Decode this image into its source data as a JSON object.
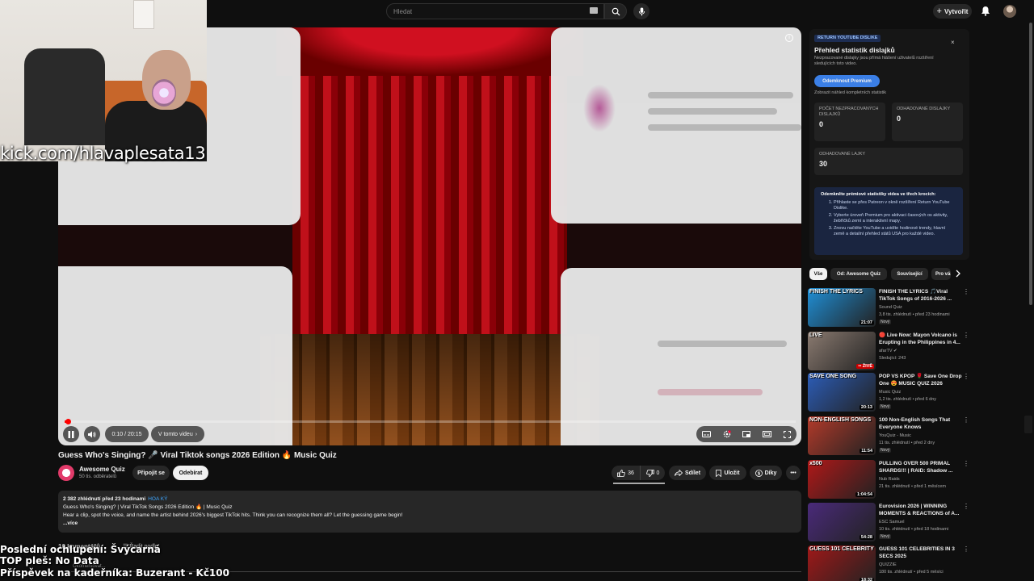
{
  "header": {
    "search_placeholder": "Hledat",
    "create_label": "Vytvořit"
  },
  "stream_overlay": {
    "kick_url": "kick.com/hlavaplesata13",
    "line1": "Poslední ochlupení: Švýcarná",
    "line2": "TOP pleš: No Data",
    "line3": "Příspěvek na kadeřníka: Buzerant - Kč100"
  },
  "player": {
    "time": "0:10 / 20:15",
    "chapter": "V tomto videu",
    "progress_fraction": 0.008
  },
  "video": {
    "title": "Guess Who's Singing? 🎤 Viral Tiktok songs 2026 Edition 🔥 Music Quiz",
    "channel": "Awesome Quiz",
    "subscribers": "50 tis. odběratelů",
    "join_label": "Připojit se",
    "subscribe_label": "Odebírat",
    "likes": "36",
    "dislikes": "0",
    "share_label": "Sdílet",
    "save_label": "Uložit",
    "thanks_label": "Díky"
  },
  "description": {
    "meta": "2 382 zhlédnutí  před 23 hodinami",
    "tag": "HOA KÝ",
    "line1": "Guess Who's Singing? | Viral TikTok Songs 2026 Edition 🔥 | Music Quiz",
    "line2": "Hear a clip, spot the voice, and name the artist behind 2026's biggest TikTok hits. Think you can recognize them all? Let the guessing game begin!",
    "more": "...více"
  },
  "comments": {
    "count_label": "10 komentářů",
    "sort_label": "Řadit podle",
    "add_placeholder": "Okomentovat..."
  },
  "ryd": {
    "badge": "RETURN YOUTUBE DISLIKE",
    "title": "Přehled statistik dislajků",
    "subtitle": "Nezpracované dislajky jsou přímá hlášení uživatelů rozšíření sledujících toto video.",
    "unlock_label": "Odemknout Premium",
    "preview_label": "Zobrazit náhled kompletních statistik",
    "stat1_label": "POČET NEZPRACOVANÝCH DISLAJKŮ",
    "stat1_value": "0",
    "stat2_label": "ODHADOVANÉ DISLAJKY",
    "stat2_value": "0",
    "stat3_label": "ODHADOVANÉ LAJKY",
    "stat3_value": "30",
    "steps_title": "Odemkněte prémiové statistiky videa ve třech krocích:",
    "step1": "Přihlaste se přes Patreon v okně rozšíření Return YouTube Dislike.",
    "step2": "Vyberte úroveň Premium pro aktivaci časových os aktivity, žebříčků zemí a interaktivní mapy.",
    "step3": "Znovu načtěte YouTube a uvidíte hodinové trendy, hlavní země a detailní přehled států USA pro každé video."
  },
  "chips": [
    "Vše",
    "Od: Awesome Quiz",
    "Související",
    "Pro vás"
  ],
  "recommendations": [
    {
      "thumb_text": "FINISH THE LYRICS",
      "thumb_color": "#1f8fd6",
      "duration": "21:07",
      "title": "FINISH THE LYRICS 🎵Viral TikTok Songs of 2016-2026 ...",
      "channel": "Sound Quiz",
      "meta": "3,8 tis. zhlédnutí • před 23 hodinami",
      "badge": "Nový"
    },
    {
      "thumb_text": "LIVE",
      "thumb_color": "#8a7a70",
      "duration": "•• ŽIVĚ",
      "title": "🔴 Live Now: Mayon Volcano is Erupting in the Philippines in 4...",
      "channel": "afarTV ✔",
      "meta": "Sledující: 243",
      "badge": ""
    },
    {
      "thumb_text": "SAVE ONE SONG",
      "thumb_color": "#2c5db8",
      "duration": "20:13",
      "title": "POP VS KPOP 🌹 Save One Drop One 😍 MUSIC QUIZ 2026",
      "channel": "Music Quiz",
      "meta": "1,2 tis. zhlédnutí • před 6 dny",
      "badge": "Nový"
    },
    {
      "thumb_text": "NON-ENGLISH SONGS",
      "thumb_color": "#b33a2a",
      "duration": "11:54",
      "title": "100 Non-English Songs That Everyone Knows",
      "channel": "YouQuiz - Music",
      "meta": "11 tis. zhlédnutí • před 2 dny",
      "badge": "Nový"
    },
    {
      "thumb_text": "x500",
      "thumb_color": "#b01818",
      "duration": "1:04:54",
      "title": "PULLING OVER 500 PRIMAL SHARDS!!! | RAID: Shadow ...",
      "channel": "Nub Raids",
      "meta": "21 tis. zhlédnutí • před 1 měsícem",
      "badge": ""
    },
    {
      "thumb_text": "",
      "thumb_color": "#4a2a7a",
      "duration": "54:28",
      "title": "Eurovision 2026 | WINNING MOMENTS & REACTIONS of A...",
      "channel": "ESC Samuel",
      "meta": "10 tis. zhlédnutí • před 18 hodinami",
      "badge": "Nový"
    },
    {
      "thumb_text": "GUESS 101 CELEBRITY",
      "thumb_color": "#a01818",
      "duration": "18:32",
      "title": "GUESS 101 CELEBRITIES IN 3 SECS 2025",
      "channel": "QUIZZIE",
      "meta": "180 tis. zhlédnutí • před 5 měsíci",
      "badge": ""
    }
  ]
}
